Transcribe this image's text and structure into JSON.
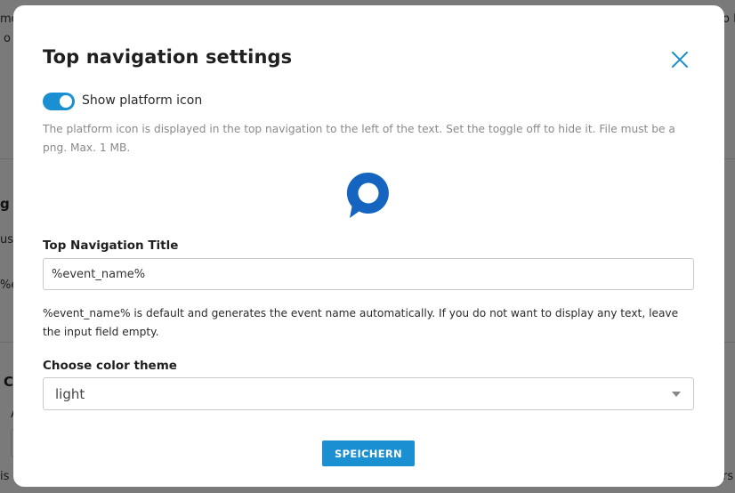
{
  "background": {
    "fragments": [
      "mo",
      "o",
      "o l",
      "g",
      "ust",
      "%e",
      "C",
      "A",
      "is",
      "rs"
    ]
  },
  "modal": {
    "title": "Top navigation settings",
    "close_icon": "close-icon",
    "toggle": {
      "label": "Show platform icon",
      "on": true
    },
    "toggle_help": "The platform icon is displayed in the top navigation to the left of the text. Set the toggle off to hide it. File must be a png. Max. 1 MB.",
    "platform_icon": "chat-bubble-icon",
    "title_field": {
      "label": "Top Navigation Title",
      "value": "%event_name%"
    },
    "title_help": "%event_name% is default and generates the event name automatically. If you do not want to display any text, leave the input field empty.",
    "theme_field": {
      "label": "Choose color theme",
      "selected": "light"
    },
    "save_label": "SPEICHERN"
  },
  "colors": {
    "accent": "#1a8fd2",
    "icon_blue": "#1565c0"
  }
}
